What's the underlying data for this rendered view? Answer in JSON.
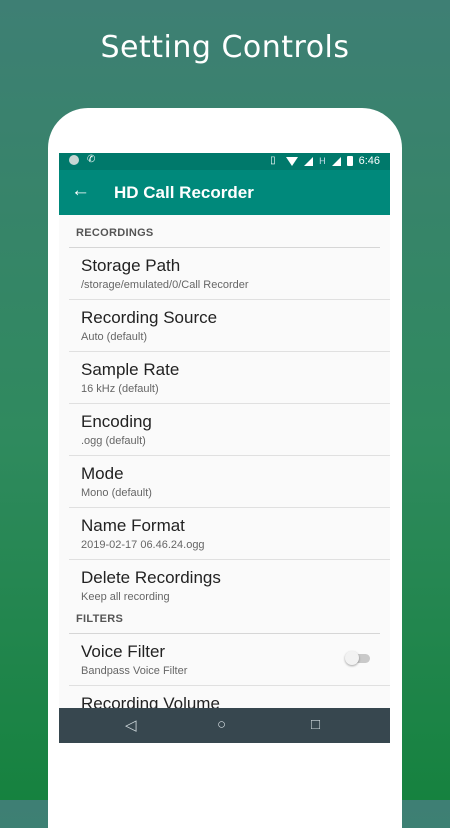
{
  "headline": "Setting Controls",
  "status_bar": {
    "time": "6:46",
    "network_label": "H"
  },
  "app_bar": {
    "title": "HD Call Recorder"
  },
  "sections": [
    {
      "header": "RECORDINGS",
      "items": [
        {
          "title": "Storage Path",
          "summary": "/storage/emulated/0/Call Recorder"
        },
        {
          "title": "Recording Source",
          "summary": "Auto (default)"
        },
        {
          "title": "Sample Rate",
          "summary": "16 kHz (default)"
        },
        {
          "title": "Encoding",
          "summary": ".ogg (default)"
        },
        {
          "title": "Mode",
          "summary": "Mono (default)"
        },
        {
          "title": "Name Format",
          "summary": "2019-02-17 06.46.24.ogg"
        },
        {
          "title": "Delete Recordings",
          "summary": "Keep all recording"
        }
      ]
    },
    {
      "header": "FILTERS",
      "items": [
        {
          "title": "Voice Filter",
          "summary": "Bandpass Voice Filter",
          "toggle": false
        },
        {
          "title": "Recording Volume",
          "summary": ""
        }
      ]
    }
  ],
  "icons": {
    "back": "arrow-left-icon",
    "nav_back": "triangle-back-icon",
    "nav_home": "circle-home-icon",
    "nav_recents": "square-recents-icon"
  },
  "colors": {
    "primary": "#00897b",
    "status_bar": "#00796b",
    "nav_bar": "#37474f"
  }
}
